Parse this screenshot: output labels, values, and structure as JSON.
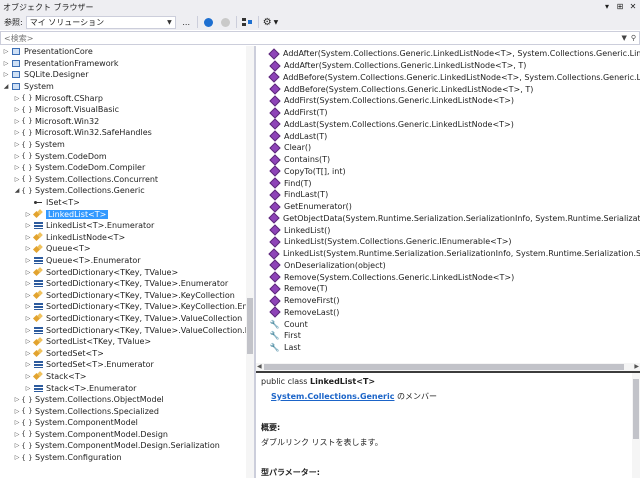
{
  "window": {
    "title": "オブジェクト ブラウザー",
    "controls": [
      "▾",
      "⊞",
      "✕"
    ]
  },
  "toolbar": {
    "browse_label": "参照:",
    "browse_value": "マイ ソリューション",
    "more_label": "..."
  },
  "search": {
    "placeholder": "<検索>"
  },
  "tree": [
    {
      "indent": 0,
      "toggle": "▷",
      "icon": "box",
      "label": "PresentationCore"
    },
    {
      "indent": 0,
      "toggle": "▷",
      "icon": "box",
      "label": "PresentationFramework"
    },
    {
      "indent": 0,
      "toggle": "▷",
      "icon": "box",
      "label": "SQLite.Designer"
    },
    {
      "indent": 0,
      "toggle": "◢",
      "icon": "box",
      "label": "System"
    },
    {
      "indent": 1,
      "toggle": "▷",
      "icon": "ns",
      "label": "Microsoft.CSharp"
    },
    {
      "indent": 1,
      "toggle": "▷",
      "icon": "ns",
      "label": "Microsoft.VisualBasic"
    },
    {
      "indent": 1,
      "toggle": "▷",
      "icon": "ns",
      "label": "Microsoft.Win32"
    },
    {
      "indent": 1,
      "toggle": "▷",
      "icon": "ns",
      "label": "Microsoft.Win32.SafeHandles"
    },
    {
      "indent": 1,
      "toggle": "▷",
      "icon": "ns",
      "label": "System"
    },
    {
      "indent": 1,
      "toggle": "▷",
      "icon": "ns",
      "label": "System.CodeDom"
    },
    {
      "indent": 1,
      "toggle": "▷",
      "icon": "ns",
      "label": "System.CodeDom.Compiler"
    },
    {
      "indent": 1,
      "toggle": "▷",
      "icon": "ns",
      "label": "System.Collections.Concurrent"
    },
    {
      "indent": 1,
      "toggle": "◢",
      "icon": "ns",
      "label": "System.Collections.Generic"
    },
    {
      "indent": 2,
      "toggle": "",
      "icon": "iface",
      "label": "ISet<T>"
    },
    {
      "indent": 2,
      "toggle": "▷",
      "icon": "class",
      "label": "LinkedList<T>",
      "selected": true
    },
    {
      "indent": 2,
      "toggle": "▷",
      "icon": "struct",
      "label": "LinkedList<T>.Enumerator"
    },
    {
      "indent": 2,
      "toggle": "▷",
      "icon": "class",
      "label": "LinkedListNode<T>"
    },
    {
      "indent": 2,
      "toggle": "▷",
      "icon": "class",
      "label": "Queue<T>"
    },
    {
      "indent": 2,
      "toggle": "▷",
      "icon": "struct",
      "label": "Queue<T>.Enumerator"
    },
    {
      "indent": 2,
      "toggle": "▷",
      "icon": "class",
      "label": "SortedDictionary<TKey, TValue>"
    },
    {
      "indent": 2,
      "toggle": "▷",
      "icon": "struct",
      "label": "SortedDictionary<TKey, TValue>.Enumerator"
    },
    {
      "indent": 2,
      "toggle": "▷",
      "icon": "class",
      "label": "SortedDictionary<TKey, TValue>.KeyCollection"
    },
    {
      "indent": 2,
      "toggle": "▷",
      "icon": "struct",
      "label": "SortedDictionary<TKey, TValue>.KeyCollection.Enu"
    },
    {
      "indent": 2,
      "toggle": "▷",
      "icon": "class",
      "label": "SortedDictionary<TKey, TValue>.ValueCollection"
    },
    {
      "indent": 2,
      "toggle": "▷",
      "icon": "struct",
      "label": "SortedDictionary<TKey, TValue>.ValueCollection.Er"
    },
    {
      "indent": 2,
      "toggle": "▷",
      "icon": "class",
      "label": "SortedList<TKey, TValue>"
    },
    {
      "indent": 2,
      "toggle": "▷",
      "icon": "class",
      "label": "SortedSet<T>"
    },
    {
      "indent": 2,
      "toggle": "▷",
      "icon": "struct",
      "label": "SortedSet<T>.Enumerator"
    },
    {
      "indent": 2,
      "toggle": "▷",
      "icon": "class",
      "label": "Stack<T>"
    },
    {
      "indent": 2,
      "toggle": "▷",
      "icon": "struct",
      "label": "Stack<T>.Enumerator"
    },
    {
      "indent": 1,
      "toggle": "▷",
      "icon": "ns",
      "label": "System.Collections.ObjectModel"
    },
    {
      "indent": 1,
      "toggle": "▷",
      "icon": "ns",
      "label": "System.Collections.Specialized"
    },
    {
      "indent": 1,
      "toggle": "▷",
      "icon": "ns",
      "label": "System.ComponentModel"
    },
    {
      "indent": 1,
      "toggle": "▷",
      "icon": "ns",
      "label": "System.ComponentModel.Design"
    },
    {
      "indent": 1,
      "toggle": "▷",
      "icon": "ns",
      "label": "System.ComponentModel.Design.Serialization"
    },
    {
      "indent": 1,
      "toggle": "▷",
      "icon": "ns",
      "label": "System.Configuration"
    }
  ],
  "members": [
    {
      "icon": "method",
      "label": "AddAfter(System.Collections.Generic.LinkedListNode<T>, System.Collections.Generic.LinkedListNode<T>)"
    },
    {
      "icon": "method",
      "label": "AddAfter(System.Collections.Generic.LinkedListNode<T>, T)"
    },
    {
      "icon": "method",
      "label": "AddBefore(System.Collections.Generic.LinkedListNode<T>, System.Collections.Generic.LinkedListNode<T>)"
    },
    {
      "icon": "method",
      "label": "AddBefore(System.Collections.Generic.LinkedListNode<T>, T)"
    },
    {
      "icon": "method",
      "label": "AddFirst(System.Collections.Generic.LinkedListNode<T>)"
    },
    {
      "icon": "method",
      "label": "AddFirst(T)"
    },
    {
      "icon": "method",
      "label": "AddLast(System.Collections.Generic.LinkedListNode<T>)"
    },
    {
      "icon": "method",
      "label": "AddLast(T)"
    },
    {
      "icon": "method",
      "label": "Clear()"
    },
    {
      "icon": "method",
      "label": "Contains(T)"
    },
    {
      "icon": "method",
      "label": "CopyTo(T[], int)"
    },
    {
      "icon": "method",
      "label": "Find(T)"
    },
    {
      "icon": "method",
      "label": "FindLast(T)"
    },
    {
      "icon": "method",
      "label": "GetEnumerator()"
    },
    {
      "icon": "method",
      "label": "GetObjectData(System.Runtime.Serialization.SerializationInfo, System.Runtime.Serialization.StreamingContext)"
    },
    {
      "icon": "method",
      "label": "LinkedList()"
    },
    {
      "icon": "method",
      "label": "LinkedList(System.Collections.Generic.IEnumerable<T>)"
    },
    {
      "icon": "method",
      "label": "LinkedList(System.Runtime.Serialization.SerializationInfo, System.Runtime.Serialization.StreamingContext)"
    },
    {
      "icon": "method",
      "label": "OnDeserialization(object)"
    },
    {
      "icon": "method",
      "label": "Remove(System.Collections.Generic.LinkedListNode<T>)"
    },
    {
      "icon": "method",
      "label": "Remove(T)"
    },
    {
      "icon": "method",
      "label": "RemoveFirst()"
    },
    {
      "icon": "method",
      "label": "RemoveLast()"
    },
    {
      "icon": "prop",
      "label": "Count"
    },
    {
      "icon": "prop",
      "label": "First"
    },
    {
      "icon": "prop",
      "label": "Last"
    }
  ],
  "description": {
    "signature_prefix": "public class ",
    "signature_name": "LinkedList<T>",
    "member_of_link": "System.Collections.Generic",
    "member_of_suffix": " のメンバー",
    "summary_heading": "概要:",
    "summary_text": "ダブルリンク リストを表します。",
    "type_params_heading": "型パラメーター:"
  },
  "colors": {
    "selection": "#3399FF",
    "link": "#1B64C8",
    "method_icon": "#8E44B8",
    "class_icon": "#E2A32F",
    "struct_icon": "#2E5C9E",
    "back_button": "#1E6FD0"
  }
}
